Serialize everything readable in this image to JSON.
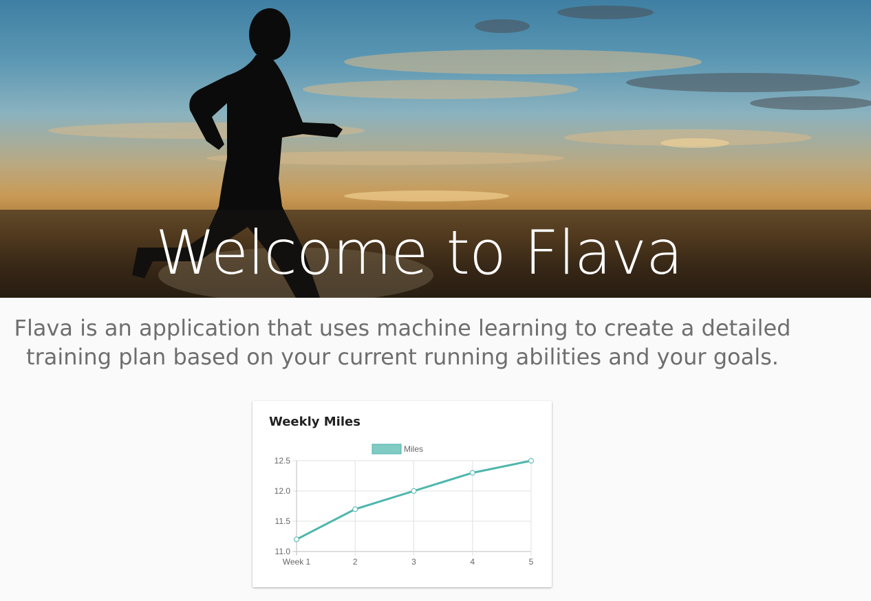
{
  "hero": {
    "title": "Welcome to Flava"
  },
  "intro": {
    "line1": "Flava is an application that uses machine learning to create a detailed",
    "line2": "training plan based on your current running abilities and your goals."
  },
  "card": {
    "title": "Weekly Miles"
  },
  "chart_data": {
    "type": "line",
    "title": "Weekly Miles",
    "categories": [
      "Week 1",
      "2",
      "3",
      "4",
      "5"
    ],
    "series": [
      {
        "name": "Miles",
        "values": [
          11.2,
          11.7,
          12.0,
          12.3,
          12.5
        ],
        "color": "#4db6ac",
        "fill": "#80cbc4"
      }
    ],
    "ylim": [
      11.0,
      12.5
    ],
    "yticks": [
      "12.5",
      "12.0",
      "11.5",
      "11.0"
    ],
    "ytick_values": [
      12.5,
      12.0,
      11.5,
      11.0
    ],
    "grid": true,
    "legend": "top-center"
  }
}
